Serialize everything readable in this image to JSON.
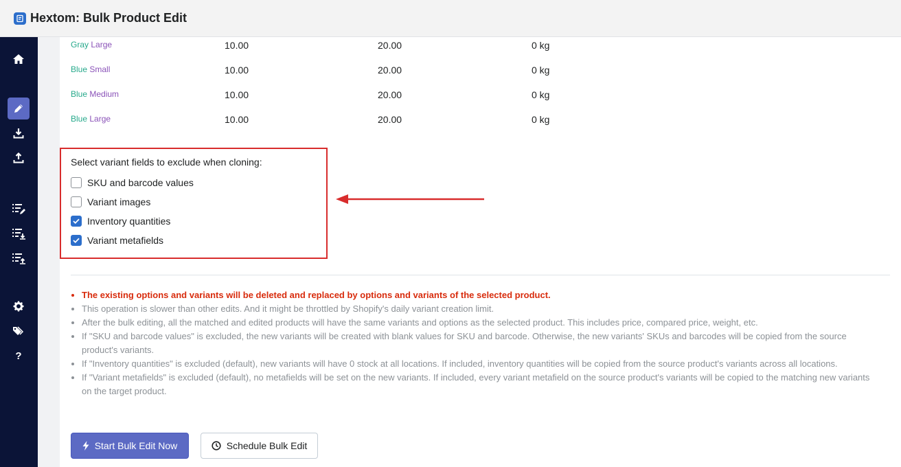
{
  "app": {
    "title": "Hextom: Bulk Product Edit"
  },
  "variants": [
    {
      "opt1": "Gray",
      "opt2": "Large",
      "price": "10.00",
      "compare_price": "20.00",
      "weight": "0 kg"
    },
    {
      "opt1": "Blue",
      "opt2": "Small",
      "price": "10.00",
      "compare_price": "20.00",
      "weight": "0 kg"
    },
    {
      "opt1": "Blue",
      "opt2": "Medium",
      "price": "10.00",
      "compare_price": "20.00",
      "weight": "0 kg"
    },
    {
      "opt1": "Blue",
      "opt2": "Large",
      "price": "10.00",
      "compare_price": "20.00",
      "weight": "0 kg"
    }
  ],
  "exclude": {
    "title": "Select variant fields to exclude when cloning:",
    "options": [
      {
        "label": "SKU and barcode values",
        "checked": false
      },
      {
        "label": "Variant images",
        "checked": false
      },
      {
        "label": "Inventory quantities",
        "checked": true
      },
      {
        "label": "Variant metafields",
        "checked": true
      }
    ]
  },
  "notes": {
    "warning": "The existing options and variants will be deleted and replaced by options and variants of the selected product.",
    "items": [
      "This operation is slower than other edits. And it might be throttled by Shopify's daily variant creation limit.",
      "After the bulk editing, all the matched and edited products will have the same variants and options as the selected product. This includes price, compared price, weight, etc.",
      "If \"SKU and barcode values\" is excluded, the new variants will be created with blank values for SKU and barcode. Otherwise, the new variants' SKUs and barcodes will be copied from the source product's variants.",
      "If \"Inventory quantities\" is excluded (default), new variants will have 0 stock at all locations. If included, inventory quantities will be copied from the source product's variants across all locations.",
      "If \"Variant metafields\" is excluded (default), no metafields will be set on the new variants. If included, every variant metafield on the source product's variants will be copied to the matching new variants on the target product."
    ]
  },
  "buttons": {
    "start": "Start Bulk Edit Now",
    "schedule": "Schedule Bulk Edit"
  },
  "colors": {
    "sidebar_bg": "#0b1437",
    "accent": "#5c6ac4",
    "checkbox": "#2c6ecb",
    "warning": "#d82c0d",
    "highlight": "#d82c2c"
  },
  "icons": {
    "sidebar": [
      "home-icon",
      "edit-icon",
      "download-icon",
      "upload-icon",
      "list-edit-icon",
      "list-download-icon",
      "list-upload-icon",
      "gear-icon",
      "tags-icon",
      "help-icon"
    ],
    "buttons": [
      "bolt-icon",
      "clock-icon"
    ]
  }
}
